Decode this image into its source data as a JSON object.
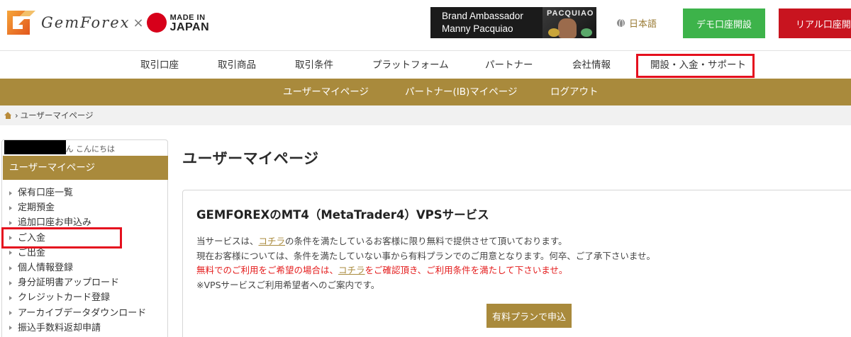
{
  "header": {
    "logo_text": "GemForex",
    "logo_separator": "×",
    "made_in_line1": "MADE IN",
    "made_in_line2": "JAPAN",
    "ambassador_line1": "Brand Ambassador",
    "ambassador_line2": "Manny Pacquiao",
    "ambassador_photo_text": "PACQUIAO",
    "language": "日本語",
    "demo_button": "デモ口座開設",
    "real_button": "リアル口座開設"
  },
  "main_nav": [
    {
      "label": "取引口座"
    },
    {
      "label": "取引商品"
    },
    {
      "label": "取引条件"
    },
    {
      "label": "プラットフォーム"
    },
    {
      "label": "パートナー"
    },
    {
      "label": "会社情報"
    },
    {
      "label": "開設・入金・サポート"
    }
  ],
  "sub_nav": [
    {
      "label": "ユーザーマイページ"
    },
    {
      "label": "パートナー(IB)マイページ"
    },
    {
      "label": "ログアウト"
    }
  ],
  "breadcrumb": {
    "separator": "›",
    "current": "ユーザーマイページ"
  },
  "sidebar": {
    "greeting": "さん こんにちは",
    "heading": "ユーザーマイページ",
    "items": [
      {
        "label": "保有口座一覧"
      },
      {
        "label": "定期預金"
      },
      {
        "label": "追加口座お申込み"
      },
      {
        "label": "ご入金"
      },
      {
        "label": "ご出金"
      },
      {
        "label": "個人情報登録"
      },
      {
        "label": "身分証明書アップロード"
      },
      {
        "label": "クレジットカード登録"
      },
      {
        "label": "アーカイブデータダウンロード"
      },
      {
        "label": "振込手数料返却申請"
      }
    ]
  },
  "main": {
    "page_title": "ユーザーマイページ",
    "card": {
      "title": "GEMFOREXのMT4（MetaTrader4）VPSサービス",
      "line1_pre": "当サービスは、",
      "line1_link": "コチラ",
      "line1_post": "の条件を満たしているお客様に限り無料で提供させて頂いております。",
      "line2": "現在お客様については、条件を満たしていない事から有料プランでのご用意となります。何卒、ご了承下さいませ。",
      "line3_pre": "無料でのご利用をご希望の場合は、",
      "line3_link": "コチラ",
      "line3_post": "をご確認頂き、ご利用条件を満たして下さいませ。",
      "line4": "※VPSサービスご利用希望者へのご案内です。",
      "button": "有料プランで申込"
    }
  },
  "colors": {
    "gold": "#a98a3c",
    "demo_green": "#3db34a",
    "real_red": "#c8141f",
    "highlight_red": "#e5101e",
    "warning_red": "#e41c1c"
  }
}
